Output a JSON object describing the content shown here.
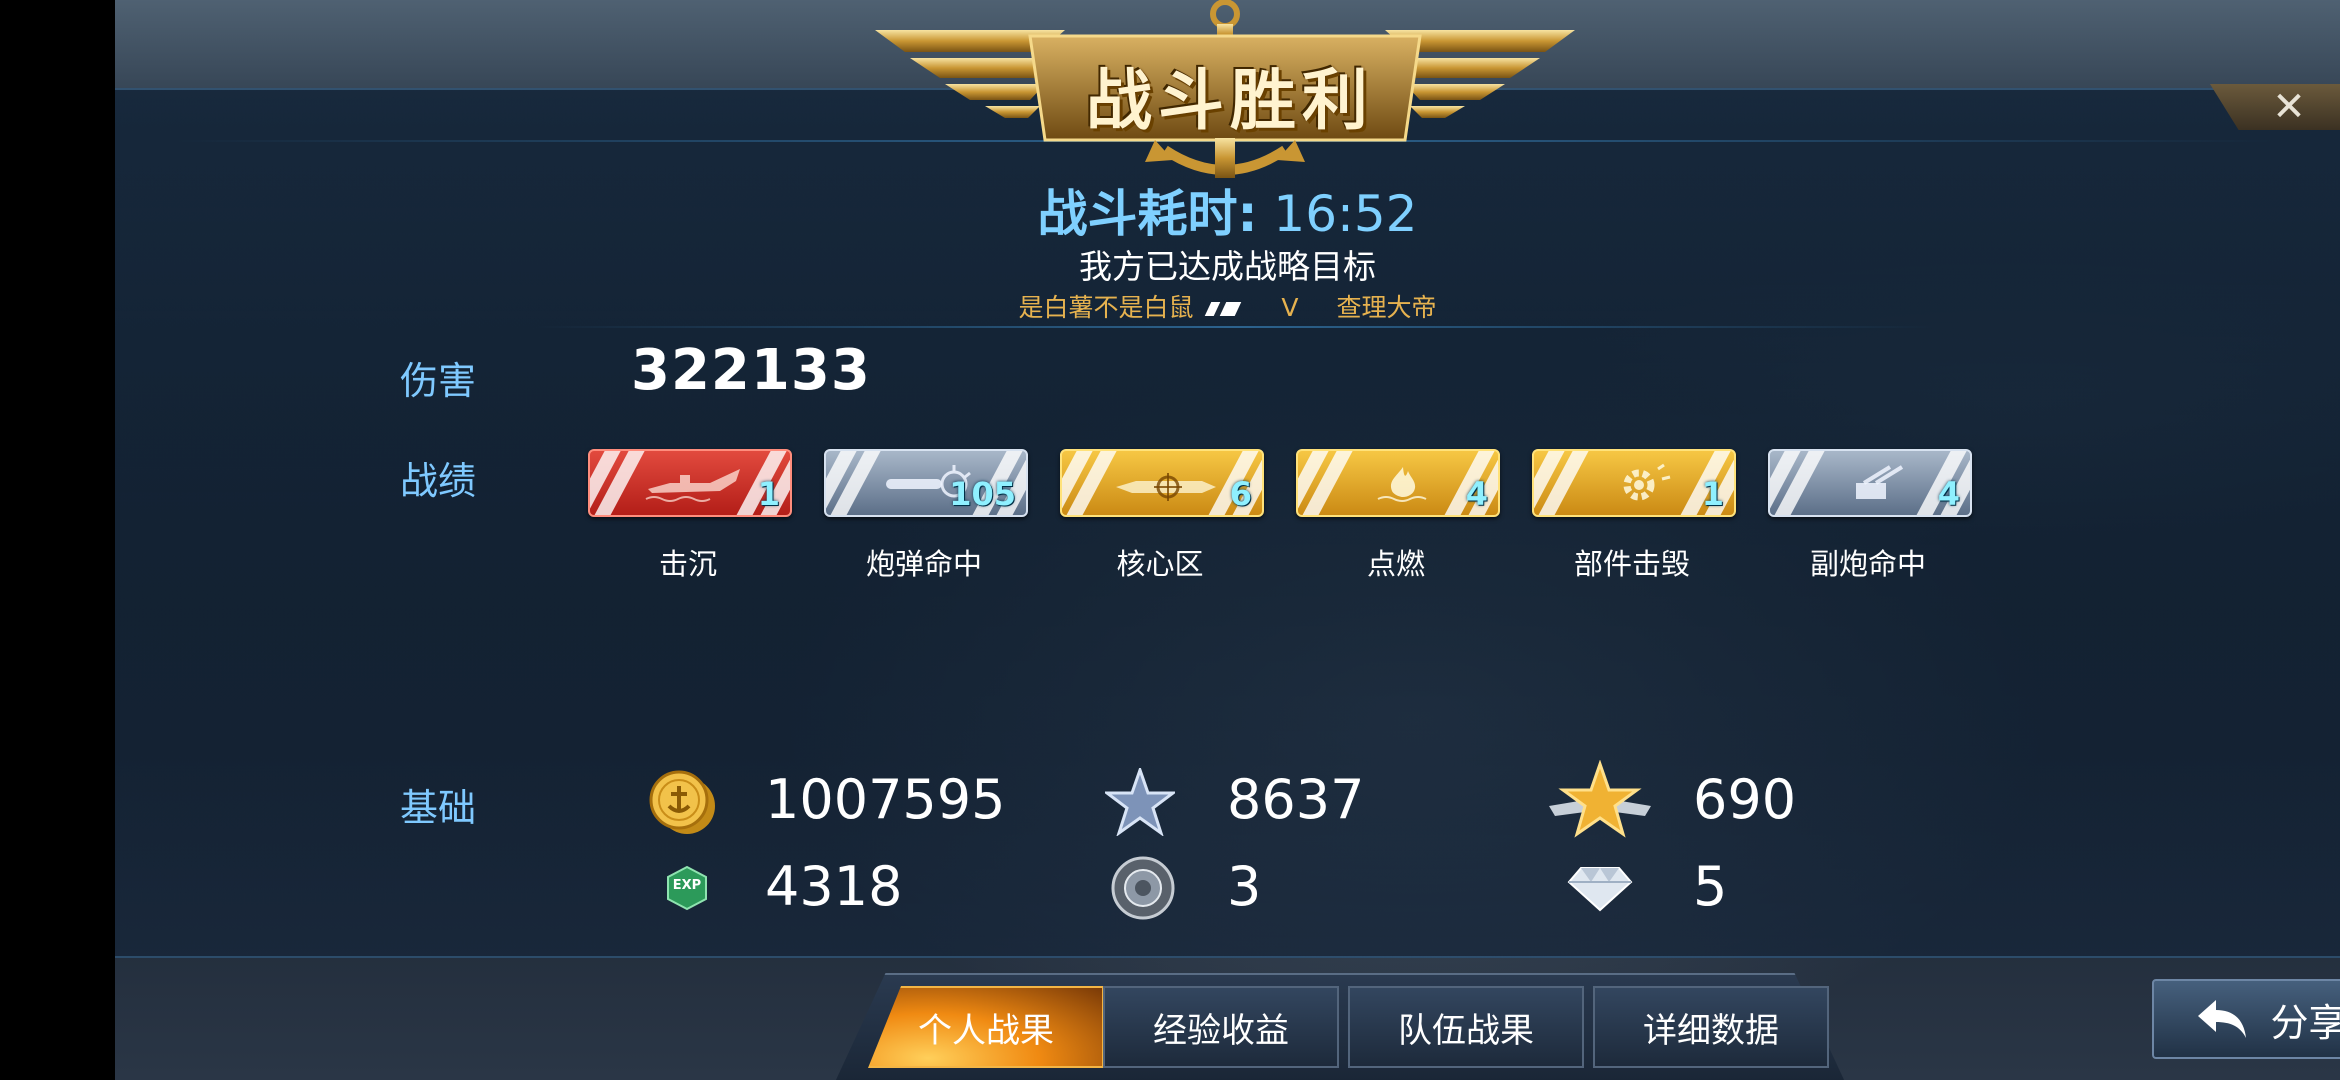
{
  "header": {
    "title": "战斗胜利",
    "close_icon": "close-icon"
  },
  "summary": {
    "battle_time_label": "战斗耗时:",
    "battle_time_value": "16:52",
    "objective": "我方已达成战略目标",
    "player_left": "是白薯不是白鼠",
    "player_mid": "V",
    "player_right": "查理大帝"
  },
  "damage": {
    "label": "伤害",
    "value": "322133"
  },
  "record": {
    "label": "战绩",
    "badges": [
      {
        "name": "击沉",
        "count": "1",
        "color": "red",
        "icon": "sunk-ship-icon"
      },
      {
        "name": "炮弹命中",
        "count": "105",
        "color": "blue",
        "icon": "shell-hit-icon"
      },
      {
        "name": "核心区",
        "count": "6",
        "color": "gold",
        "icon": "citadel-icon"
      },
      {
        "name": "点燃",
        "count": "4",
        "color": "gold",
        "icon": "fire-icon"
      },
      {
        "name": "部件击毁",
        "count": "1",
        "color": "gold",
        "icon": "module-destroyed-icon"
      },
      {
        "name": "副炮命中",
        "count": "4",
        "color": "blue",
        "icon": "secondary-gun-icon"
      }
    ]
  },
  "base": {
    "label": "基础",
    "resources": [
      {
        "icon": "gold-coin-icon",
        "value": "1007595"
      },
      {
        "icon": "silver-star-icon",
        "value": "8637"
      },
      {
        "icon": "gold-star-rank-icon",
        "value": "690"
      },
      {
        "icon": "exp-icon",
        "icon_text": "EXP",
        "value": "4318"
      },
      {
        "icon": "steel-orb-icon",
        "value": "3"
      },
      {
        "icon": "diamond-icon",
        "value": "5"
      }
    ]
  },
  "tabs": [
    "个人战果",
    "经验收益",
    "队伍战果",
    "详细数据"
  ],
  "active_tab": 0,
  "share": {
    "label": "分享",
    "icon": "share-arrow-icon"
  },
  "colors": {
    "accent_blue": "#7fd0ff",
    "gold": "#e6b24f",
    "red_badge": "#c9302a",
    "count_cyan": "#8ff0ff"
  }
}
